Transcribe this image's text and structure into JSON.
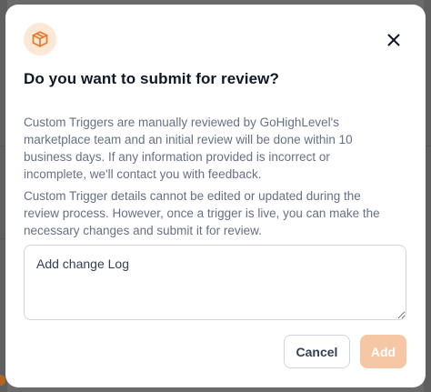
{
  "dialog": {
    "title": "Do you want to submit for review?",
    "paragraph_1": "Custom Triggers are manually reviewed by GoHighLevel's marketplace team and an initial review will be done within 10 business days. If any information provided is incorrect or incomplete, we'll contact you with feedback.",
    "paragraph_2": "Custom Trigger details cannot be edited or updated during the review process. However, once a trigger is live, you can make the necessary changes and submit it for review.",
    "change_log_placeholder": "Add change Log",
    "change_log_value": "",
    "cancel_label": "Cancel",
    "add_label": "Add",
    "header_icon": "package-icon",
    "close_icon": "close-icon"
  },
  "colors": {
    "accent": "#f5c7a5",
    "icon_bg": "#fde8d6",
    "icon_stroke": "#e8772e",
    "overlay": "#6b6b6b"
  }
}
